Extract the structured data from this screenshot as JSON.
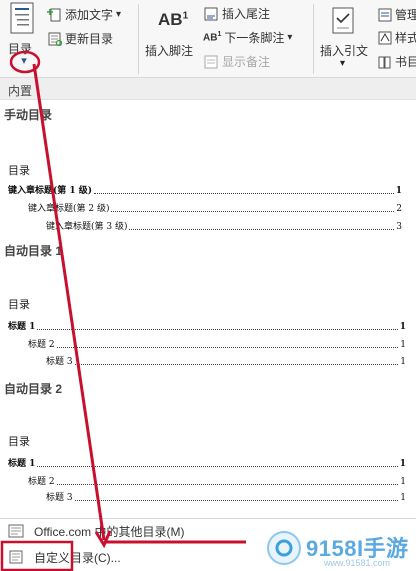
{
  "ribbon": {
    "toc_button": {
      "label": "目录",
      "dropdown": "▾"
    },
    "add_text": "添加文字",
    "add_text_arrow": "▾",
    "update_toc": "更新目录",
    "footnote_glyph": "AB",
    "footnote_sup": "1",
    "insert_footnote": "插入脚注",
    "insert_endnote": "插入尾注",
    "next_footnote": "下一条脚注",
    "next_footnote_arrow": "▾",
    "show_notes": "显示备注",
    "insert_citation": "插入引文",
    "insert_citation_arrow": "▾",
    "manage_sources": "管理",
    "style": "样式",
    "bibliography": "书目"
  },
  "gallery": {
    "builtin_header": "内置",
    "entries": [
      {
        "title": "手动目录",
        "toc_heading": "目录",
        "lines": [
          {
            "label": "键入章标题(第 1 级)",
            "page": "1"
          },
          {
            "label": "键入章标题(第 2 级)",
            "page": "2"
          },
          {
            "label": "键入章标题(第 3 级)",
            "page": "3"
          }
        ]
      },
      {
        "title": "自动目录 1",
        "toc_heading": "目录",
        "lines": [
          {
            "label": "标题 1",
            "page": "1"
          },
          {
            "label": "标题 2",
            "page": "1"
          },
          {
            "label": "标题 3",
            "page": "1"
          }
        ]
      },
      {
        "title": "自动目录 2",
        "toc_heading": "目录",
        "lines": [
          {
            "label": "标题 1",
            "page": "1"
          },
          {
            "label": "标题 2",
            "page": "1"
          },
          {
            "label": "标题 3",
            "page": "1"
          }
        ]
      }
    ],
    "more_from_office": "Office.com 中的其他目录(M)",
    "custom_toc": "自定义目录(C)..."
  },
  "watermark": {
    "text": "9158I手游",
    "url": "www.91581.com"
  },
  "colors": {
    "annotation_red": "#c8102e",
    "ribbon_bg": "#f7f7f7",
    "icon_blue": "#2b5797"
  }
}
